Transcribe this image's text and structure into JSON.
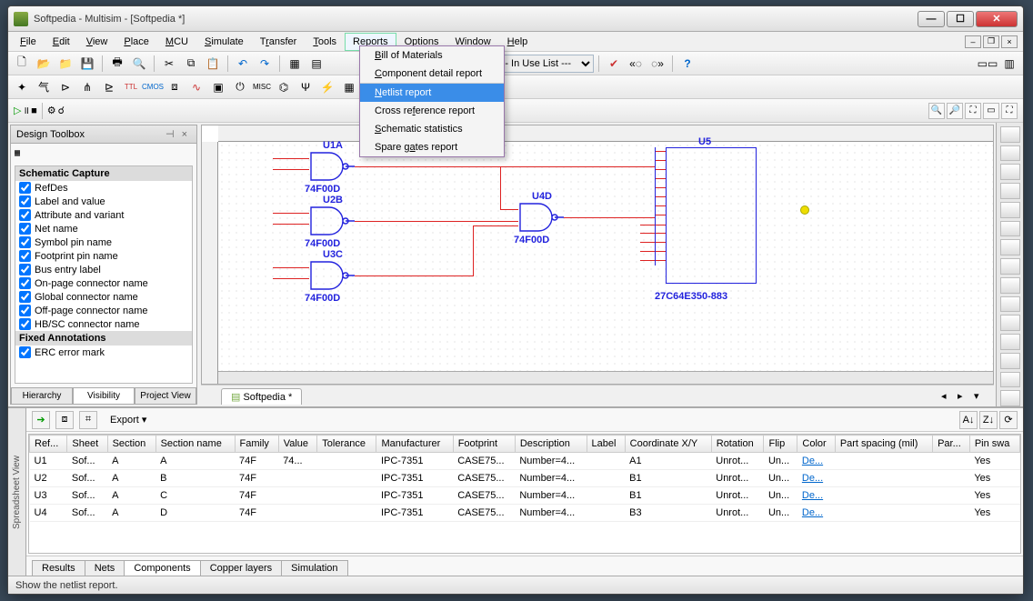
{
  "window": {
    "title": "Softpedia - Multisim - [Softpedia *]"
  },
  "menubar": {
    "items": [
      "File",
      "Edit",
      "View",
      "Place",
      "MCU",
      "Simulate",
      "Transfer",
      "Tools",
      "Reports",
      "Options",
      "Window",
      "Help"
    ],
    "open_index": 8
  },
  "reports_menu": {
    "items": [
      "Bill of Materials",
      "Component detail report",
      "Netlist report",
      "Cross reference report",
      "Schematic statistics",
      "Spare gates report"
    ],
    "hover_index": 2
  },
  "toolbar": {
    "use_list_label": "--- In Use List ---"
  },
  "design_toolbox": {
    "title": "Design Toolbox",
    "section1": "Schematic Capture",
    "items": [
      "RefDes",
      "Label and value",
      "Attribute and variant",
      "Net name",
      "Symbol pin name",
      "Footprint pin name",
      "Bus entry label",
      "On-page connector name",
      "Global connector name",
      "Off-page connector name",
      "HB/SC connector name"
    ],
    "section2": "Fixed Annotations",
    "items2": [
      "ERC error mark"
    ],
    "tabs": [
      "Hierarchy",
      "Visibility",
      "Project View"
    ],
    "active_tab": 1
  },
  "schematic": {
    "labels": {
      "U1A": "U1A",
      "U1A_type": "74F00D",
      "U2B": "U2B",
      "U2B_type": "74F00D",
      "U3C": "U3C",
      "U3C_type": "74F00D",
      "U4D": "U4D",
      "U4D_type": "74F00D",
      "U5": "U5",
      "U5_type": "27C64E350-883"
    },
    "doc_tab": "Softpedia *"
  },
  "spreadsheet": {
    "sidebar": "Spreadsheet View",
    "export": "Export",
    "columns": [
      "Ref...",
      "Sheet",
      "Section",
      "Section name",
      "Family",
      "Value",
      "Tolerance",
      "Manufacturer",
      "Footprint",
      "Description",
      "Label",
      "Coordinate X/Y",
      "Rotation",
      "Flip",
      "Color",
      "Part spacing (mil)",
      "Par...",
      "Pin swa"
    ],
    "rows": [
      {
        "ref": "U1",
        "sheet": "Sof...",
        "section": "A",
        "section_name": "A",
        "family": "74F",
        "value": "74...",
        "tolerance": "",
        "manufacturer": "IPC-7351",
        "footprint": "CASE75...",
        "description": "Number=4...",
        "label": "",
        "coord": "A1",
        "rotation": "Unrot...",
        "flip": "Un...",
        "color": "De...",
        "pin": "Yes"
      },
      {
        "ref": "U2",
        "sheet": "Sof...",
        "section": "A",
        "section_name": "B",
        "family": "74F",
        "value": "",
        "tolerance": "",
        "manufacturer": "IPC-7351",
        "footprint": "CASE75...",
        "description": "Number=4...",
        "label": "",
        "coord": "B1",
        "rotation": "Unrot...",
        "flip": "Un...",
        "color": "De...",
        "pin": "Yes"
      },
      {
        "ref": "U3",
        "sheet": "Sof...",
        "section": "A",
        "section_name": "C",
        "family": "74F",
        "value": "",
        "tolerance": "",
        "manufacturer": "IPC-7351",
        "footprint": "CASE75...",
        "description": "Number=4...",
        "label": "",
        "coord": "B1",
        "rotation": "Unrot...",
        "flip": "Un...",
        "color": "De...",
        "pin": "Yes"
      },
      {
        "ref": "U4",
        "sheet": "Sof...",
        "section": "A",
        "section_name": "D",
        "family": "74F",
        "value": "",
        "tolerance": "",
        "manufacturer": "IPC-7351",
        "footprint": "CASE75...",
        "description": "Number=4...",
        "label": "",
        "coord": "B3",
        "rotation": "Unrot...",
        "flip": "Un...",
        "color": "De...",
        "pin": "Yes"
      }
    ],
    "tabs": [
      "Results",
      "Nets",
      "Components",
      "Copper layers",
      "Simulation"
    ],
    "active_tab": 2
  },
  "statusbar": {
    "text": "Show the netlist report."
  }
}
